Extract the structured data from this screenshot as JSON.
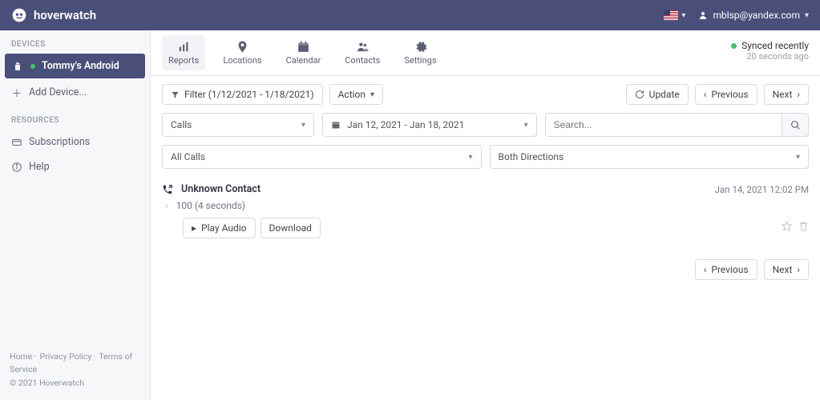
{
  "brand": {
    "name": "hoverwatch"
  },
  "user": {
    "email": "mblsp@yandex.com"
  },
  "sidebar": {
    "devices_label": "DEVICES",
    "device_name": "Tommy's Android",
    "add_device": "Add Device...",
    "resources_label": "RESOURCES",
    "subscriptions": "Subscriptions",
    "help": "Help"
  },
  "footer": {
    "home": "Home",
    "privacy": "Privacy Policy",
    "terms": "Terms of Service",
    "copyright": "© 2021 Hoverwatch"
  },
  "tabs": {
    "reports": "Reports",
    "locations": "Locations",
    "calendar": "Calendar",
    "contacts": "Contacts",
    "settings": "Settings"
  },
  "sync": {
    "status": "Synced recently",
    "ago": "20 seconds ago"
  },
  "filterbar": {
    "filter_label": "Filter (1/12/2021 - 1/18/2021)",
    "action_label": "Action",
    "update": "Update",
    "previous": "Previous",
    "next": "Next"
  },
  "filters": {
    "type": "Calls",
    "date_range": "Jan 12, 2021 - Jan 18, 2021",
    "search_placeholder": "Search...",
    "all_calls": "All Calls",
    "direction": "Both Directions"
  },
  "record": {
    "title": "Unknown Contact",
    "subtitle": "100 (4 seconds)",
    "timestamp": "Jan 14, 2021 12:02 PM",
    "play": "Play Audio",
    "download": "Download"
  },
  "pager": {
    "previous": "Previous",
    "next": "Next"
  }
}
